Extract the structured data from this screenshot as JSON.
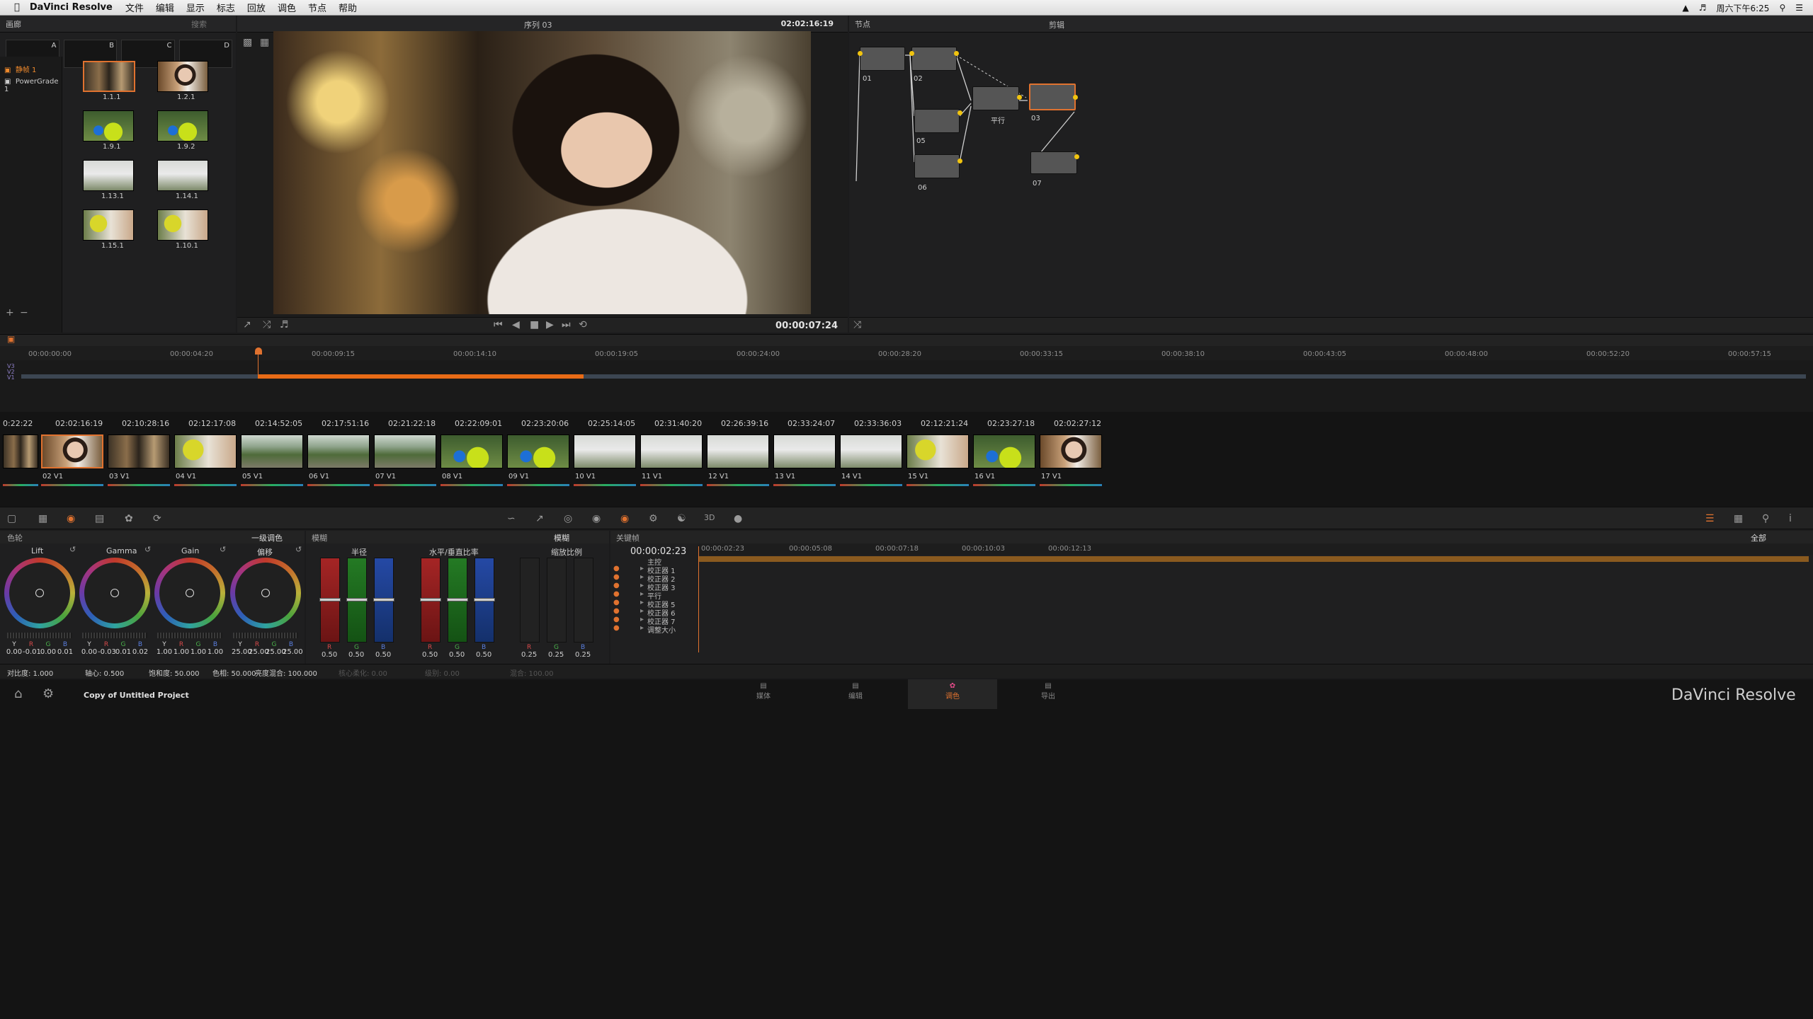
{
  "menubar": {
    "apple": "",
    "app": "DaVinci Resolve",
    "items": [
      "文件",
      "编辑",
      "显示",
      "标志",
      "回放",
      "调色",
      "节点",
      "帮助"
    ],
    "clock": "周六下午6:25"
  },
  "gallery": {
    "title": "画廊",
    "search_placeholder": "搜索",
    "slots": [
      "A",
      "B",
      "C",
      "D"
    ],
    "albums": [
      "静帧 1",
      "PowerGrade 1"
    ],
    "stills": [
      "1.1.1",
      "1.2.1",
      "1.9.1",
      "1.9.2",
      "1.13.1",
      "1.14.1",
      "1.15.1",
      "1.10.1"
    ]
  },
  "viewer": {
    "sequence": "序列 03",
    "timecode_top": "02:02:16:19",
    "timecode_bottom": "00:00:07:24"
  },
  "nodes": {
    "title": "节点",
    "clip_label": "剪辑",
    "items": [
      "01",
      "02",
      "平行",
      "03",
      "05",
      "06",
      "07"
    ]
  },
  "timeline": {
    "ruler": [
      "00:00:00:00",
      "00:00:04:20",
      "00:00:09:15",
      "00:00:14:10",
      "00:00:19:05",
      "00:00:24:00",
      "00:00:28:20",
      "00:00:33:15",
      "00:00:38:10",
      "00:00:43:05",
      "00:00:48:00",
      "00:00:52:20",
      "00:00:57:15"
    ],
    "tracks": [
      "V3",
      "V2",
      "V1"
    ]
  },
  "clips": {
    "timecodes": [
      "0:22:22",
      "02:02:16:19",
      "02:10:28:16",
      "02:12:17:08",
      "02:14:52:05",
      "02:17:51:16",
      "02:21:22:18",
      "02:22:09:01",
      "02:23:20:06",
      "02:25:14:05",
      "02:31:40:20",
      "02:26:39:16",
      "02:33:24:07",
      "02:33:36:03",
      "02:12:21:24",
      "02:23:27:18",
      "02:02:27:12"
    ],
    "labels": [
      "",
      "02  V1",
      "03  V1",
      "04  V1",
      "05  V1",
      "06  V1",
      "07  V1",
      "08  V1",
      "09  V1",
      "10  V1",
      "11  V1",
      "12  V1",
      "13  V1",
      "14  V1",
      "15  V1",
      "16  V1",
      "17  V1"
    ]
  },
  "primary": {
    "title": "色轮",
    "mode": "一级调色",
    "wheels": [
      {
        "name": "Lift",
        "vals": [
          "0.00",
          "-0.01",
          "0.00",
          "0.01"
        ]
      },
      {
        "name": "Gamma",
        "vals": [
          "0.00",
          "-0.03",
          "0.01",
          "0.02"
        ]
      },
      {
        "name": "Gain",
        "vals": [
          "1.00",
          "1.00",
          "1.00",
          "1.00"
        ]
      },
      {
        "name": "偏移",
        "vals": [
          "25.00",
          "25.00",
          "25.00",
          "25.00"
        ]
      }
    ],
    "channels": [
      "Y",
      "R",
      "G",
      "B"
    ],
    "footer": {
      "contrast": "对比度: 1.000",
      "pivot": "轴心: 0.500",
      "sat": "饱和度: 50.000",
      "hue": "色相: 50.000",
      "lummix": "亮度混合: 100.000"
    }
  },
  "blur": {
    "title": "模糊",
    "mode": "模糊",
    "groups": [
      {
        "name": "半径",
        "vals": [
          "0.50",
          "0.50",
          "0.50"
        ]
      },
      {
        "name": "水平/垂直比率",
        "vals": [
          "0.50",
          "0.50",
          "0.50"
        ]
      },
      {
        "name": "缩放比例",
        "vals": [
          "0.25",
          "0.25",
          "0.25"
        ]
      }
    ],
    "rgb": [
      "R",
      "G",
      "B"
    ],
    "footer": [
      "核心柔化: 0.00",
      "级别: 0.00",
      "混合: 100.00"
    ]
  },
  "keyframes": {
    "title": "关键帧",
    "scope": "全部",
    "timecode": "00:00:02:23",
    "ruler": [
      "00:00:02:23",
      "00:00:05:08",
      "00:00:07:18",
      "00:00:10:03",
      "00:00:12:13"
    ],
    "rows": [
      "主控",
      "校正器 1",
      "校正器 2",
      "校正器 3",
      "平行",
      "校正器 5",
      "校正器 6",
      "校正器 7",
      "调整大小"
    ]
  },
  "bottombar": {
    "project": "Copy of Untitled Project",
    "pages": [
      "媒体",
      "编辑",
      "调色",
      "导出"
    ],
    "brand": "DaVinci Resolve"
  }
}
